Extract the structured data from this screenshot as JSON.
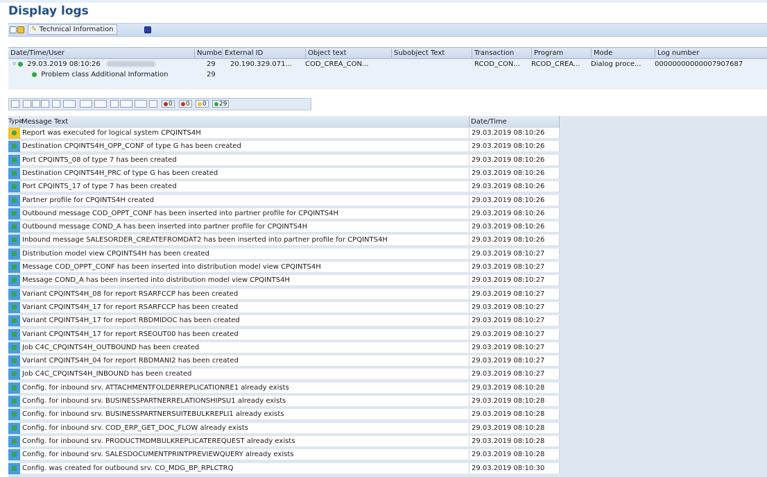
{
  "title": "Display logs",
  "toolbar": {
    "technical_info_label": "Technical Information"
  },
  "header_table": {
    "columns": [
      "Date/Time/User",
      "Numbe",
      "External ID",
      "Object text",
      "Subobject Text",
      "Transaction",
      "Program",
      "Mode",
      "Log number"
    ],
    "row": {
      "datetime": "29.03.2019  08:10:26",
      "number": "29",
      "external_id": "20.190.329.071...",
      "object_text": "COD_CREA_CON...",
      "subobject_text": "",
      "transaction": "RCOD_CON...",
      "program": "RCOD_CREA...",
      "mode": "Dialog proce...",
      "log_number": "00000000000007907687"
    },
    "subrow": {
      "label": "Problem class Additional Information",
      "value": "29"
    }
  },
  "message_toolbar": {
    "count_error_stop": "0",
    "count_error": "0",
    "count_warning": "0",
    "count_success": "29"
  },
  "messages": {
    "columns": {
      "type": "Type",
      "text": "Message Text",
      "datetime": "Date/Time"
    },
    "rows": [
      {
        "text": "Report was executed for logical system CPQINTS4H",
        "datetime": "29.03.2019 08:10:26"
      },
      {
        "text": "Destination CPQINTS4H_OPP_CONF of type G has been created",
        "datetime": "29.03.2019 08:10:26"
      },
      {
        "text": "Port CPQINTS_08 of type 7 has been created",
        "datetime": "29.03.2019 08:10:26"
      },
      {
        "text": "Destination CPQINTS4H_PRC of type G has been created",
        "datetime": "29.03.2019 08:10:26"
      },
      {
        "text": "Port CPQINTS_17 of type 7 has been created",
        "datetime": "29.03.2019 08:10:26"
      },
      {
        "text": "Partner profile for CPQINTS4H created",
        "datetime": "29.03.2019 08:10:26"
      },
      {
        "text": "Outbound message COD_OPPT_CONF has been inserted into partner profile for CPQINTS4H",
        "datetime": "29.03.2019 08:10:26"
      },
      {
        "text": "Outbound message COND_A has been inserted into partner profile for CPQINTS4H",
        "datetime": "29.03.2019 08:10:26"
      },
      {
        "text": "Inbound message SALESORDER_CREATEFROMDAT2 has been inserted into partner profile for CPQINTS4H",
        "datetime": "29.03.2019 08:10:26"
      },
      {
        "text": "Distribution model view CPQINTS4H has been created",
        "datetime": "29.03.2019 08:10:27"
      },
      {
        "text": "Message COD_OPPT_CONF has been inserted into distribution model view CPQINTS4H",
        "datetime": "29.03.2019 08:10:27"
      },
      {
        "text": "Message COND_A has been inserted into distribution model view CPQINTS4H",
        "datetime": "29.03.2019 08:10:27"
      },
      {
        "text": "Variant CPQINTS4H_08 for report RSARFCCP has been created",
        "datetime": "29.03.2019 08:10:27"
      },
      {
        "text": "Variant CPQINTS4H_17 for report RSARFCCP has been created",
        "datetime": "29.03.2019 08:10:27"
      },
      {
        "text": "Variant CPQINTS4H_17 for report RBDMIDOC has been created",
        "datetime": "29.03.2019 08:10:27"
      },
      {
        "text": "Variant CPQINTS4H_17 for report RSEOUT00 has been created",
        "datetime": "29.03.2019 08:10:27"
      },
      {
        "text": "Job C4C_CPQINTS4H_OUTBOUND has been created",
        "datetime": "29.03.2019 08:10:27"
      },
      {
        "text": "Variant CPQINTS4H_04 for report RBDMANI2 has been created",
        "datetime": "29.03.2019 08:10:27"
      },
      {
        "text": "Job C4C_CPQINTS4H_INBOUND has been created",
        "datetime": "29.03.2019 08:10:27"
      },
      {
        "text": "Config. for inbound srv. ATTACHMENTFOLDERREPLICATIONRE1 already exists",
        "datetime": "29.03.2019 08:10:28"
      },
      {
        "text": "Config. for inbound srv. BUSINESSPARTNERRELATIONSHIPSU1 already exists",
        "datetime": "29.03.2019 08:10:28"
      },
      {
        "text": "Config. for inbound srv. BUSINESSPARTNERSUITEBULKREPLI1 already exists",
        "datetime": "29.03.2019 08:10:28"
      },
      {
        "text": "Config. for inbound srv. COD_ERP_GET_DOC_FLOW already exists",
        "datetime": "29.03.2019 08:10:28"
      },
      {
        "text": "Config. for inbound srv. PRODUCTMDMBULKREPLICATEREQUEST already exists",
        "datetime": "29.03.2019 08:10:28"
      },
      {
        "text": "Config. for inbound srv. SALESDOCUMENTPRINTPREVIEWQUERY already exists",
        "datetime": "29.03.2019 08:10:28"
      },
      {
        "text": "Config. was created for outbound srv. CO_MDG_BP_RPLCTRQ",
        "datetime": "29.03.2019 08:10:30"
      }
    ]
  }
}
